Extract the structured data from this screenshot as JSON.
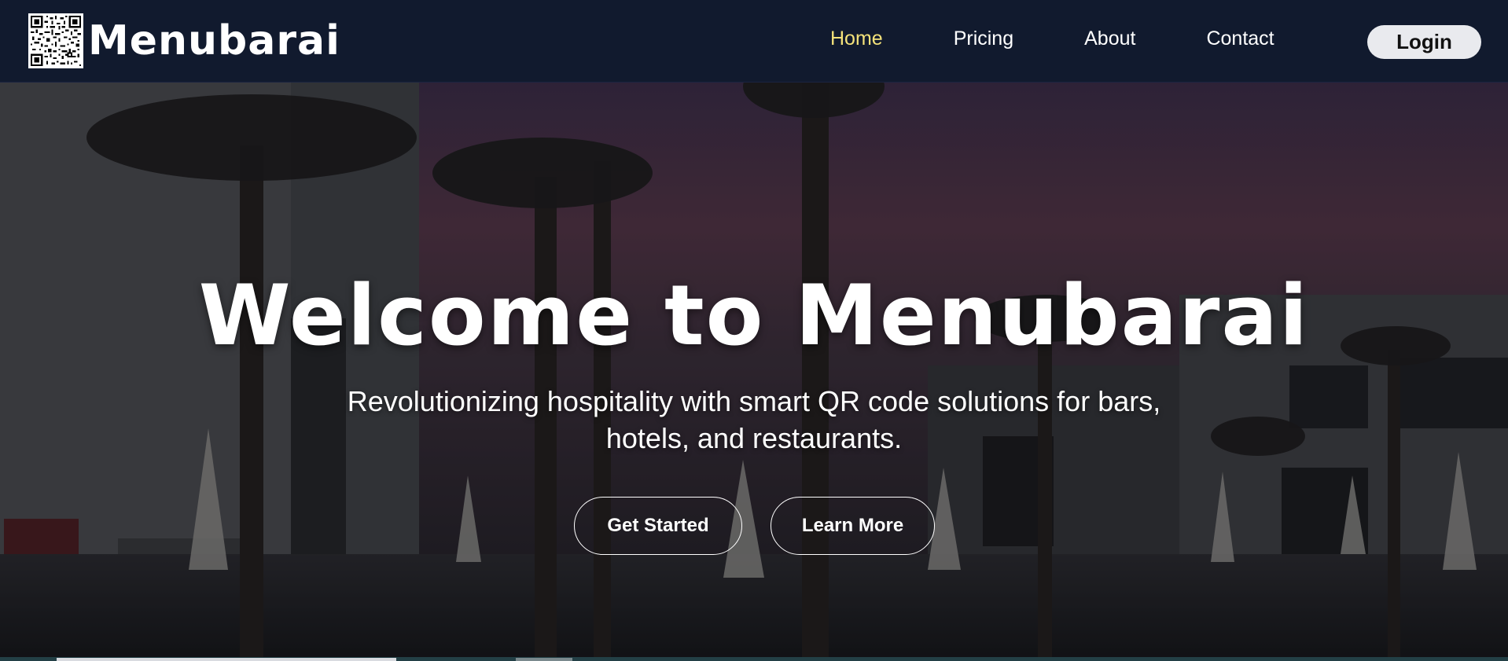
{
  "brand": {
    "name": "Menubarai",
    "logo_icon": "qr-code-icon"
  },
  "nav": {
    "items": [
      {
        "label": "Home",
        "active": true
      },
      {
        "label": "Pricing",
        "active": false
      },
      {
        "label": "About",
        "active": false
      },
      {
        "label": "Contact",
        "active": false
      }
    ],
    "login_label": "Login",
    "active_color": "#f4e27a"
  },
  "hero": {
    "title": "Welcome to Menubarai",
    "subtitle": "Revolutionizing hospitality with smart QR code solutions for bars, hotels, and restaurants.",
    "primary_button": "Get Started",
    "secondary_button": "Learn More"
  },
  "colors": {
    "navbar_bg": "#111a2e",
    "login_bg": "#e9eaee",
    "text": "#ffffff"
  }
}
